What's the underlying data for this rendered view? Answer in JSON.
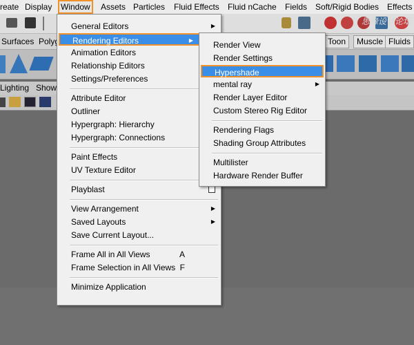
{
  "menubar": {
    "items": [
      "reate",
      "Display",
      "Window",
      "Assets",
      "Particles",
      "Fluid Effects",
      "Fluid nCache",
      "Fields",
      "Soft/Rigid Bodies",
      "Effects"
    ]
  },
  "shelf_tabs": {
    "left": [
      "Surfaces",
      "Polyg"
    ],
    "right": [
      "Toon",
      "Muscle",
      "Fluids"
    ]
  },
  "panel_menu": {
    "items": [
      "Lighting",
      "Show"
    ]
  },
  "watermark": "思缘设计论坛",
  "window_menu": {
    "groups": [
      [
        {
          "label": "General Editors",
          "sub": true
        },
        {
          "label": "Rendering Editors",
          "sub": true,
          "highlight": true
        },
        {
          "label": "Animation Editors",
          "sub": true
        },
        {
          "label": "Relationship Editors",
          "sub": true
        },
        {
          "label": "Settings/Preferences",
          "sub": true
        }
      ],
      [
        {
          "label": "Attribute Editor"
        },
        {
          "label": "Outliner"
        },
        {
          "label": "Hypergraph: Hierarchy"
        },
        {
          "label": "Hypergraph: Connections"
        }
      ],
      [
        {
          "label": "Paint Effects"
        },
        {
          "label": "UV Texture Editor"
        }
      ],
      [
        {
          "label": "Playblast"
        }
      ],
      [
        {
          "label": "View Arrangement",
          "sub": true
        },
        {
          "label": "Saved Layouts",
          "sub": true
        },
        {
          "label": "Save Current Layout..."
        }
      ],
      [
        {
          "label": "Frame All in All Views",
          "shortcut": "A"
        },
        {
          "label": "Frame Selection in All Views",
          "shortcut": "F"
        }
      ],
      [
        {
          "label": "Minimize Application"
        }
      ]
    ]
  },
  "rendering_menu": {
    "groups": [
      [
        {
          "label": "Render View"
        },
        {
          "label": "Render Settings"
        },
        {
          "label": "Hypershade",
          "highlight": true
        },
        {
          "label": "mental ray",
          "sub": true
        },
        {
          "label": "Render Layer Editor"
        },
        {
          "label": "Custom Stereo Rig Editor"
        }
      ],
      [
        {
          "label": "Rendering Flags"
        },
        {
          "label": "Shading Group Attributes"
        }
      ],
      [
        {
          "label": "Multilister"
        },
        {
          "label": "Hardware Render Buffer"
        }
      ]
    ]
  },
  "colors": {
    "highlight": "#3a8ee6",
    "outline": "#f0912a"
  }
}
